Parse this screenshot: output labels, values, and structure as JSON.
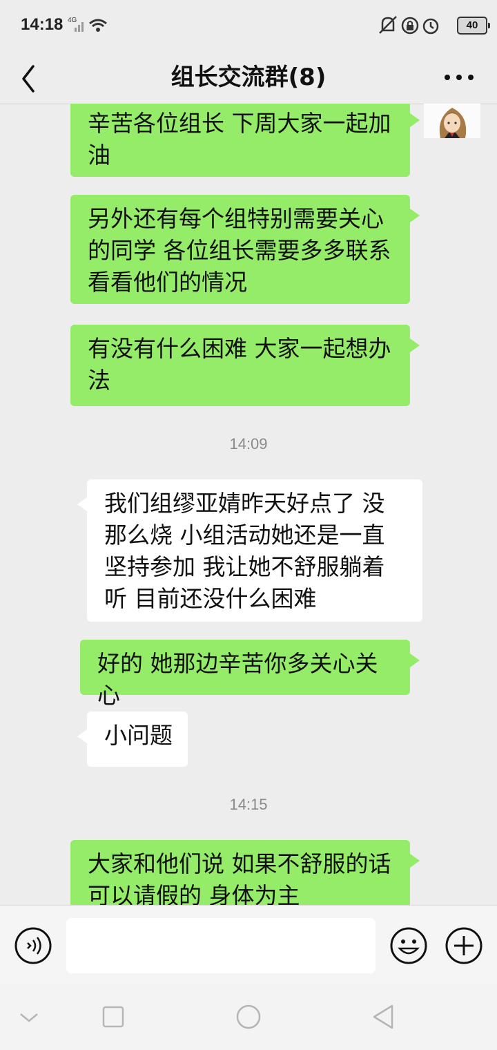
{
  "status_bar": {
    "time": "14:18",
    "network": "4G",
    "battery": "40"
  },
  "nav": {
    "title": "组长交流群(8)"
  },
  "messages": [
    {
      "side": "me",
      "text": "辛苦各位组长 下周大家一起加油"
    },
    {
      "side": "me",
      "text": "另外还有每个组特别需要关心的同学 各位组长需要多多联系 看看他们的情况"
    },
    {
      "side": "me",
      "text": "有没有什么困难 大家一起想办法"
    },
    {
      "type": "time",
      "text": "14:09"
    },
    {
      "side": "other",
      "text": "我们组缪亚婧昨天好点了 没那么烧 小组活动她还是一直坚持参加 我让她不舒服躺着听 目前还没什么困难"
    },
    {
      "side": "me",
      "text": "好的 她那边辛苦你多关心关心"
    },
    {
      "side": "other",
      "text": "小问题"
    },
    {
      "type": "time",
      "text": "14:15"
    },
    {
      "side": "me",
      "text": "大家和他们说 如果不舒服的话可以请假的 身体为主"
    }
  ],
  "colors": {
    "background": "#ededed",
    "my_bubble": "#95ec69",
    "other_bubble": "#ffffff"
  },
  "icons": {
    "back": "chevron-left-icon",
    "more": "more-dots-icon",
    "voice": "voice-icon",
    "emoji": "emoji-icon",
    "plus": "plus-icon"
  }
}
